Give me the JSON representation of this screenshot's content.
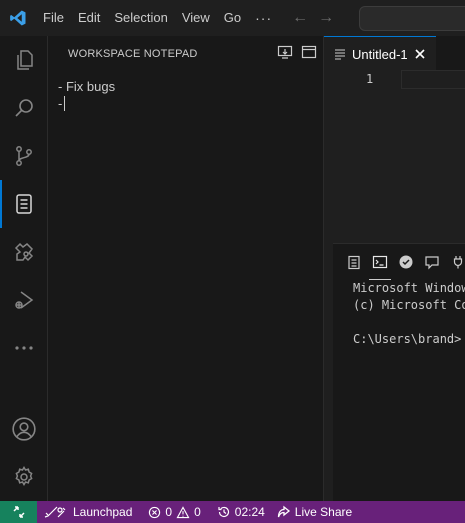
{
  "titlebar": {
    "menu": [
      "File",
      "Edit",
      "Selection",
      "View",
      "Go"
    ],
    "more": "···",
    "back_arrow": "←",
    "forward_arrow": "→"
  },
  "activitybar": {
    "items": [
      "explorer-icon",
      "search-icon",
      "source-control-icon",
      "notepad-icon",
      "extensions-icon",
      "run-debug-icon",
      "more-icon"
    ],
    "bottom": [
      "account-icon",
      "settings-gear-icon"
    ],
    "accent": "#0078d4"
  },
  "sidebar": {
    "title": "WORKSPACE NOTEPAD",
    "lines": [
      "- Fix bugs",
      "-"
    ]
  },
  "editor": {
    "tab_label": "Untitled-1",
    "line_number": "1"
  },
  "panel": {
    "terminal_lines": [
      "Microsoft Windows",
      "(c) Microsoft Co",
      "",
      "C:\\Users\\brand>"
    ]
  },
  "statusbar": {
    "background": "#68217a",
    "remote_color": "#16825d",
    "launchpad": "Launchpad",
    "errors": "0",
    "warnings": "0",
    "timer": "02:24",
    "live_share": "Live Share"
  }
}
